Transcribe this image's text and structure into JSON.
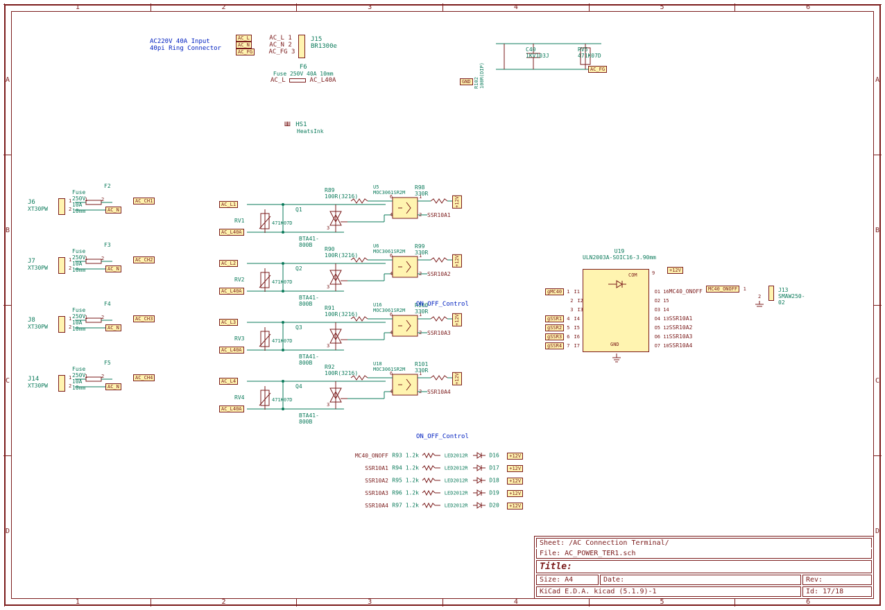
{
  "header_note1": "AC220V 40A Input",
  "header_note2": "40pi Ring Connector",
  "J15": {
    "ref": "J15",
    "val": "BR1300e",
    "p1": "AC_L 1",
    "p2": "AC_N 2",
    "p3": "AC_FG 3",
    "nl1": "AC_L",
    "nl2": "AC_N",
    "nl3": "AC_FG"
  },
  "F6": {
    "ref": "F6",
    "desc": "Fuse 250V 40A 10mm",
    "l": "AC_L",
    "r": "AC_L40A"
  },
  "HS1": {
    "ref": "HS1",
    "val": "HeatsInk"
  },
  "gnd": "GND",
  "R102": {
    "ref": "R102",
    "val": "100R(DIP)"
  },
  "C40": {
    "ref": "C40",
    "val": "1KV103J"
  },
  "RV5": {
    "ref": "RV5",
    "val": "471K07D"
  },
  "ac_fg": "AC_FG",
  "fuseCh": [
    {
      "j": "J6",
      "jval": "XT30PW",
      "f": "F2",
      "fdesc": "Fuse 250V 10A 10mm",
      "ch": "AC_CH1",
      "n": "AC_N"
    },
    {
      "j": "J7",
      "jval": "XT30PW",
      "f": "F3",
      "fdesc": "Fuse 250V 10A 10mm",
      "ch": "AC_CH2",
      "n": "AC_N"
    },
    {
      "j": "J8",
      "jval": "XT30PW",
      "f": "F4",
      "fdesc": "Fuse 250V 10A 10mm",
      "ch": "AC_CH3",
      "n": "AC_N"
    },
    {
      "j": "J14",
      "jval": "XT30PW",
      "f": "F5",
      "fdesc": "Fuse 250V 10A 10mm",
      "ch": "AC_CH4",
      "n": "AC_N"
    }
  ],
  "ssr": [
    {
      "acl": "AC_L1",
      "acl40": "AC_L40A",
      "rv": "RV1",
      "rvv": "471K07D",
      "q": "Q1",
      "qv": "BTA41-800B",
      "r": "R89",
      "rv2": "100R(3216)",
      "u": "U5",
      "uv": "MOC3061SR2M",
      "rr": "R98",
      "rrv": "330R",
      "out": "SSR10A1",
      "v12": "+12V"
    },
    {
      "acl": "AC_L2",
      "acl40": "AC_L40A",
      "rv": "RV2",
      "rvv": "471K07D",
      "q": "Q2",
      "qv": "BTA41-800B",
      "r": "R90",
      "rv2": "100R(3216)",
      "u": "U6",
      "uv": "MOC3061SR2M",
      "rr": "R99",
      "rrv": "330R",
      "out": "SSR10A2",
      "v12": "+12V"
    },
    {
      "acl": "AC_L3",
      "acl40": "AC_L40A",
      "rv": "RV3",
      "rvv": "471K07D",
      "q": "Q3",
      "qv": "BTA41-800B",
      "r": "R91",
      "rv2": "100R(3216)",
      "u": "U16",
      "uv": "MOC3061SR2M",
      "rr": "R100",
      "rrv": "330R",
      "out": "SSR10A3",
      "v12": "+12V"
    },
    {
      "acl": "AC_L4",
      "acl40": "AC_L40A",
      "rv": "RV4",
      "rvv": "471K07D",
      "q": "Q4",
      "qv": "BTA41-800B",
      "r": "R92",
      "rv2": "100R(3216)",
      "u": "U18",
      "uv": "MOC3061SR2M",
      "rr": "R101",
      "rrv": "330R",
      "out": "SSR10A4",
      "v12": "+12V"
    }
  ],
  "onoff": "ON_OFF_Control",
  "leds": [
    {
      "n": "MC40_ONOFF",
      "r": "R93",
      "rv": "1.2k",
      "lv": "LED2012R",
      "d": "D16",
      "p": "+12V"
    },
    {
      "n": "SSR10A1",
      "r": "R94",
      "rv": "1.2k",
      "lv": "LED2012R",
      "d": "D17",
      "p": "+12V"
    },
    {
      "n": "SSR10A2",
      "r": "R95",
      "rv": "1.2k",
      "lv": "LED2012R",
      "d": "D18",
      "p": "+12V"
    },
    {
      "n": "SSR10A3",
      "r": "R96",
      "rv": "1.2k",
      "lv": "LED2012R",
      "d": "D19",
      "p": "+12V"
    },
    {
      "n": "SSR10A4",
      "r": "R97",
      "rv": "1.2k",
      "lv": "LED2012R",
      "d": "D20",
      "p": "+12V"
    }
  ],
  "U19": {
    "ref": "U19",
    "val": "ULN2003A-SOIC16-3.90mm",
    "com": "COM",
    "gnd": "GND",
    "v12": "+12V",
    "left": [
      {
        "pin": "1",
        "name": "I1",
        "net": "gMC40"
      },
      {
        "pin": "2",
        "name": "I2",
        "net": ""
      },
      {
        "pin": "3",
        "name": "I3",
        "net": ""
      },
      {
        "pin": "4",
        "name": "I4",
        "net": "gSSR1"
      },
      {
        "pin": "5",
        "name": "I5",
        "net": "gSSR2"
      },
      {
        "pin": "6",
        "name": "I6",
        "net": "gSSR3"
      },
      {
        "pin": "7",
        "name": "I7",
        "net": "gSSR4"
      }
    ],
    "right": [
      {
        "pin": "16",
        "name": "O1",
        "net": "MC40_ONOFF"
      },
      {
        "pin": "15",
        "name": "O2",
        "net": ""
      },
      {
        "pin": "14",
        "name": "O3",
        "net": ""
      },
      {
        "pin": "13",
        "name": "O4",
        "net": "SSR10A1"
      },
      {
        "pin": "12",
        "name": "O5",
        "net": "SSR10A2"
      },
      {
        "pin": "11",
        "name": "O6",
        "net": "SSR10A3"
      },
      {
        "pin": "10",
        "name": "O7",
        "net": "SSR10A4"
      }
    ]
  },
  "J13": {
    "ref": "J13",
    "val": "SMAW250-02",
    "net": "MC40_ONOFF",
    "p1": "1",
    "p2": "2"
  },
  "title": {
    "sheet": "Sheet: /AC Connection Terminal/",
    "file": "File: AC_POWER_TER1.sch",
    "titleLabel": "Title:",
    "size": "Size: A4",
    "date": "Date:",
    "rev": "Rev:",
    "gen": "KiCad E.D.A.  kicad (5.1.9)-1",
    "id": "Id: 17/18"
  },
  "ruler_h": [
    "1",
    "2",
    "3",
    "4",
    "5",
    "6"
  ],
  "ruler_v": [
    "A",
    "B",
    "C",
    "D"
  ]
}
